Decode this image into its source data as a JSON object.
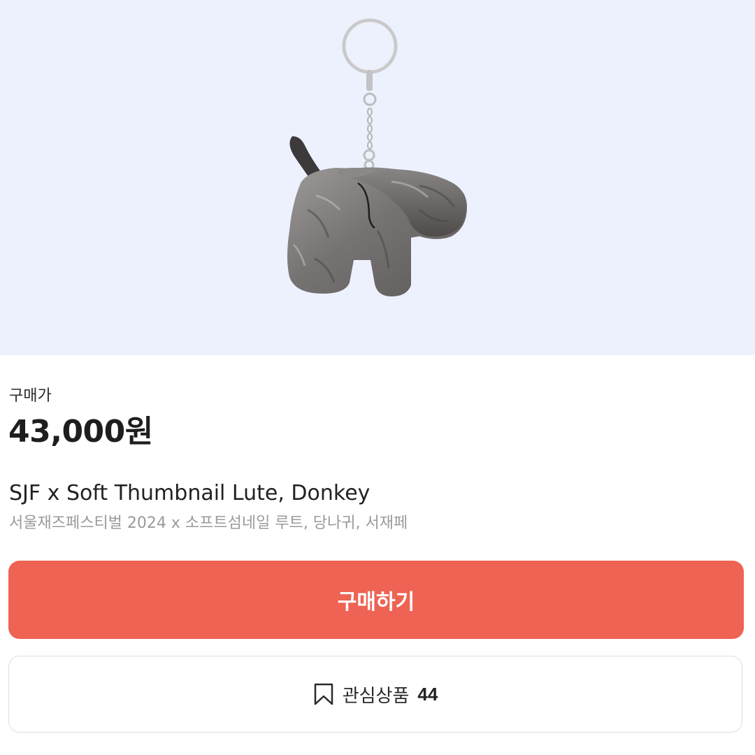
{
  "product_image": {
    "icon": "donkey-plush-keychain-image",
    "background_color": "#ecf1fd"
  },
  "price": {
    "label": "구매가",
    "value": "43,000원"
  },
  "product": {
    "title": "SJF x Soft Thumbnail Lute, Donkey",
    "subtitle": "서울재즈페스티벌 2024 x 소프트섬네일 루트, 당나귀, 서재페"
  },
  "buy_button": {
    "label": "구매하기",
    "color": "#ee6353"
  },
  "wishlist_button": {
    "icon": "bookmark-icon",
    "label": "관심상품",
    "count": "44"
  }
}
